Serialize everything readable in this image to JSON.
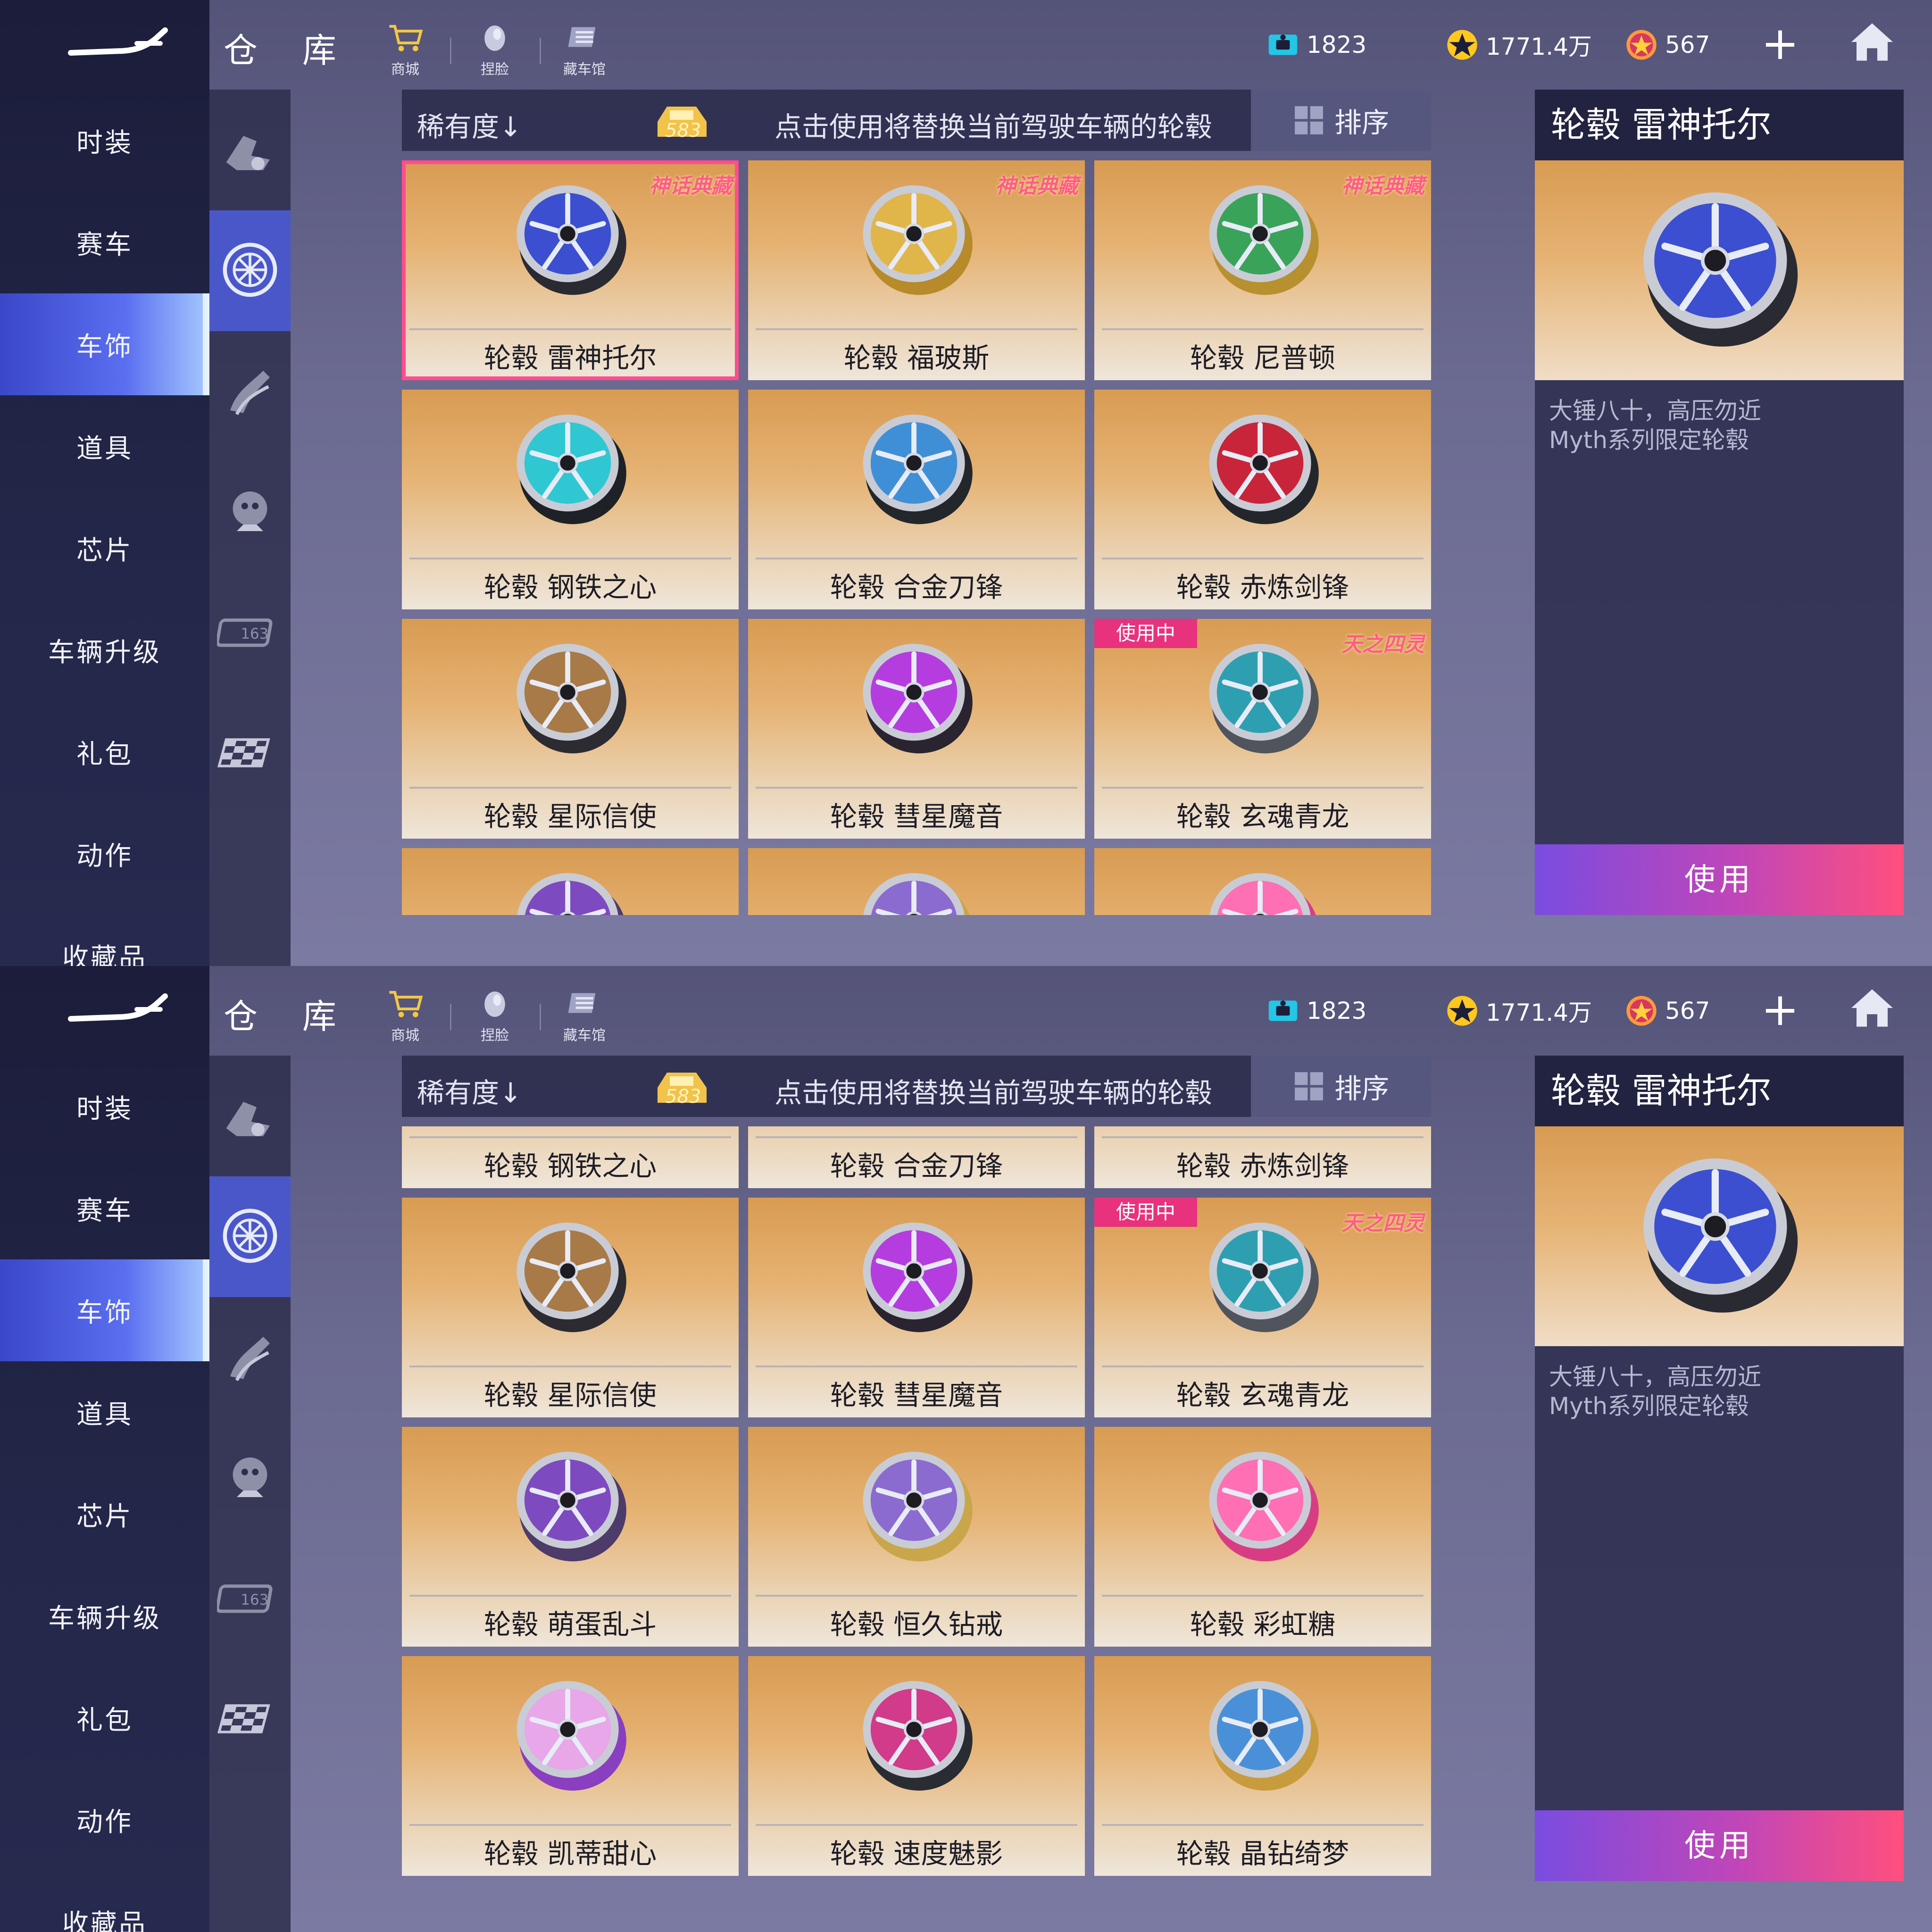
{
  "header": {
    "title": "仓 库",
    "tools": [
      {
        "label": "商城",
        "icon": "cart-icon"
      },
      {
        "label": "捏脸",
        "icon": "face-icon"
      },
      {
        "label": "藏车馆",
        "icon": "garage-icon"
      }
    ],
    "currencies": [
      {
        "value": "1823",
        "icon": "ticket-icon",
        "color": "#24c6e6"
      },
      {
        "value": "1771.4万",
        "icon": "star-coin-icon",
        "color": "#ffc71f"
      },
      {
        "value": "567",
        "icon": "gem-coin-icon",
        "color": "#ff7a3d"
      }
    ],
    "plus": "+"
  },
  "nav": {
    "items": [
      "时装",
      "赛车",
      "车饰",
      "道具",
      "芯片",
      "车辆升级",
      "礼包",
      "动作",
      "收藏品"
    ],
    "active_index": 2
  },
  "subnav": {
    "icons": [
      "car-part-icon",
      "wheel-icon",
      "flame-exhaust-icon",
      "mascot-icon",
      "license-plate-icon",
      "checkered-flag-icon"
    ],
    "active_index": 1
  },
  "list_header": {
    "sort_label": "稀有度↓",
    "count": "583",
    "hint": "点击使用将替换当前驾驶车辆的轮毂",
    "sort_button": "排序"
  },
  "series_tags": {
    "myth": "神话典藏",
    "sky": "天之四灵"
  },
  "items": [
    {
      "name": "轮毂 雷神托尔",
      "tag": "myth",
      "hub": "#3b4fd0",
      "rim": "#2a2a33",
      "selected": true
    },
    {
      "name": "轮毂 福玻斯",
      "tag": "myth",
      "hub": "#e0b54a",
      "rim": "#b78a2a"
    },
    {
      "name": "轮毂 尼普顿",
      "tag": "myth",
      "hub": "#3aa35a",
      "rim": "#b7902f"
    },
    {
      "name": "轮毂 钢铁之心",
      "hub": "#2fc7d2",
      "rim": "#1e2226"
    },
    {
      "name": "轮毂 合金刀锋",
      "hub": "#3f8fd6",
      "rim": "#23272c"
    },
    {
      "name": "轮毂 赤炼剑锋",
      "hub": "#c8253a",
      "rim": "#23272c"
    },
    {
      "name": "轮毂 星际信使",
      "hub": "#a87a48",
      "rim": "#2b2b31"
    },
    {
      "name": "轮毂 彗星魔音",
      "hub": "#b53de0",
      "rim": "#2a2430"
    },
    {
      "name": "轮毂 玄魂青龙",
      "tag": "sky",
      "hub": "#2e9fb0",
      "rim": "#50545c",
      "in_use": true
    },
    {
      "name": "轮毂 萌蛋乱斗",
      "hub": "#7e4ac0",
      "rim": "#4d3b6a"
    },
    {
      "name": "轮毂 恒久钻戒",
      "hub": "#8b6bd0",
      "rim": "#c9a64a"
    },
    {
      "name": "轮毂 彩虹糖",
      "hub": "#ff6fb3",
      "rim": "#d83d84"
    },
    {
      "name": "轮毂 凯蒂甜心",
      "hub": "#e7a7e8",
      "rim": "#8a3ec0"
    },
    {
      "name": "轮毂 速度魅影",
      "hub": "#d23a8a",
      "rim": "#2a2c33"
    },
    {
      "name": "轮毂 晶钻绮梦",
      "hub": "#4a90d8",
      "rim": "#c89b3d"
    }
  ],
  "in_use_label": "使用中",
  "detail": {
    "title": "轮毂 雷神托尔",
    "desc_line1": "大锤八十，高压勿近",
    "desc_line2": "Myth系列限定轮毂",
    "hub": "#3b4fd0",
    "rim": "#2a2a33"
  },
  "use_button": "使用"
}
